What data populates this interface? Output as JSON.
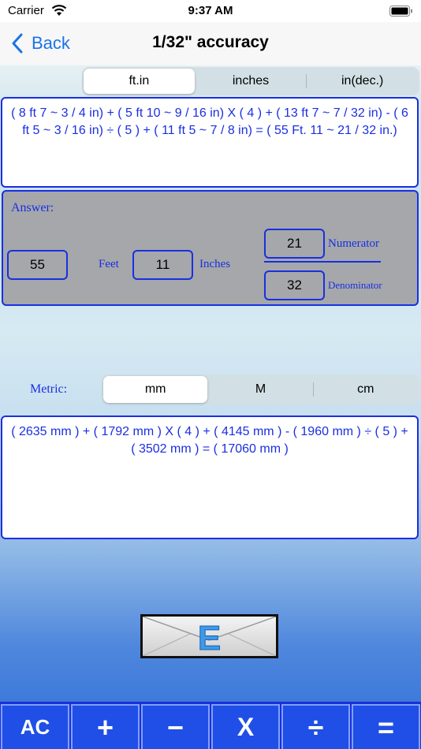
{
  "status_bar": {
    "carrier": "Carrier",
    "time": "9:37 AM"
  },
  "nav": {
    "back_label": "Back",
    "title": "1/32\" accuracy"
  },
  "unit_tabs": [
    {
      "label": "ft.in",
      "selected": true
    },
    {
      "label": "inches",
      "selected": false
    },
    {
      "label": "in(dec.)",
      "selected": false
    }
  ],
  "imperial_expression": "( 8 ft 7 ~ 3 / 4 in)  +  ( 5 ft 10 ~ 9 / 16 in)  X  ( 4 )  +  ( 13 ft 7 ~ 7 / 32 in)  -  ( 6 ft 5 ~ 3 / 16 in)  ÷  ( 5 )  +  ( 11 ft 5 ~ 7 / 8 in)  =  ( 55 Ft. 11 ~ 21 / 32 in.)",
  "answer": {
    "label": "Answer:",
    "feet_value": "55",
    "feet_label": "Feet",
    "inches_value": "11",
    "inches_label": "Inches",
    "numerator_value": "21",
    "numerator_label": "Numerator",
    "denominator_value": "32",
    "denominator_label": "Denominator"
  },
  "metric": {
    "label": "Metric:",
    "tabs": [
      {
        "label": "mm",
        "selected": true
      },
      {
        "label": "M",
        "selected": false
      },
      {
        "label": "cm",
        "selected": false
      }
    ],
    "expression": "( 2635 mm )  +  ( 1792 mm )  X  ( 4 )  +  ( 4145 mm )  -  ( 1960 mm )  ÷  ( 5 )  +  ( 3502 mm )  =   ( 17060 mm )"
  },
  "email_button": {
    "icon": "envelope-icon",
    "letter": "E"
  },
  "keypad": [
    {
      "label": "AC",
      "name": "ac-key"
    },
    {
      "label": "+",
      "name": "plus-key"
    },
    {
      "label": "−",
      "name": "minus-key"
    },
    {
      "label": "X",
      "name": "multiply-key"
    },
    {
      "label": "÷",
      "name": "divide-key"
    },
    {
      "label": "=",
      "name": "equals-key"
    }
  ],
  "colors": {
    "accent": "#1a2fe0",
    "ios_blue": "#1a73e8",
    "panel_gray": "#a5a7aa",
    "keypad_blue": "#1f4fe6"
  }
}
